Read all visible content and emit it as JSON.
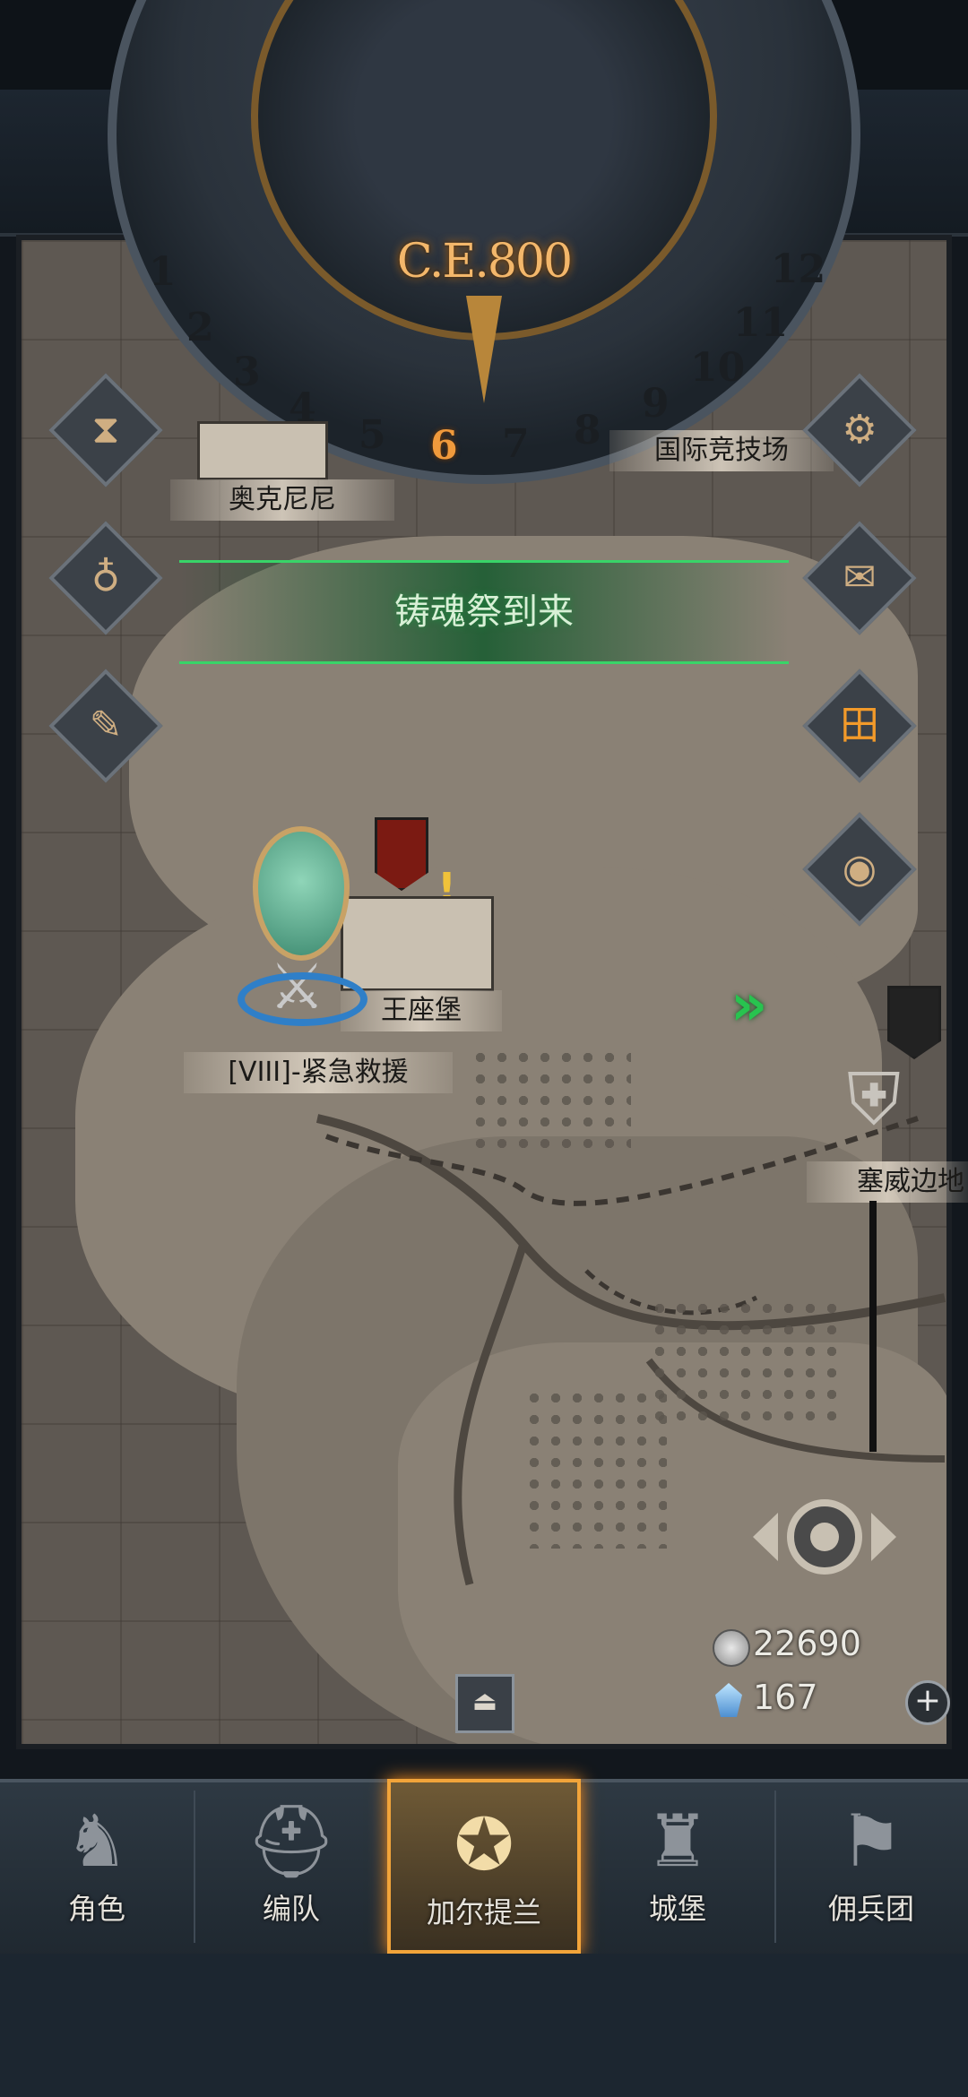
{
  "calendar": {
    "era": "C.E.800",
    "months": [
      "1",
      "2",
      "3",
      "4",
      "5",
      "6",
      "7",
      "8",
      "9",
      "10",
      "11",
      "12"
    ],
    "current_month": "6"
  },
  "map": {
    "locations": [
      {
        "name": "奥克尼尼"
      },
      {
        "name": "国际竞技场"
      },
      {
        "name": "王座堡"
      },
      {
        "name": "塞威边地"
      }
    ],
    "event_banner": "铸魂祭到来",
    "quest_label": "[VIII]-紧急救援"
  },
  "currencies": {
    "silver": "22690",
    "crystal": "167"
  },
  "side_left": [
    "hourglass-icon",
    "pouch-icon",
    "scroll-icon"
  ],
  "side_right": [
    "gear-icon",
    "mail-icon",
    "grid-icon",
    "coin-icon"
  ],
  "bottom_nav": {
    "items": [
      {
        "label": "角色"
      },
      {
        "label": "编队"
      },
      {
        "label": "加尔提兰"
      },
      {
        "label": "城堡"
      },
      {
        "label": "佣兵团"
      }
    ],
    "active_index": 2
  },
  "colors": {
    "active_tab": "#f2a43a",
    "banner_green": "#38d468",
    "era_text": "#f3b76b"
  }
}
